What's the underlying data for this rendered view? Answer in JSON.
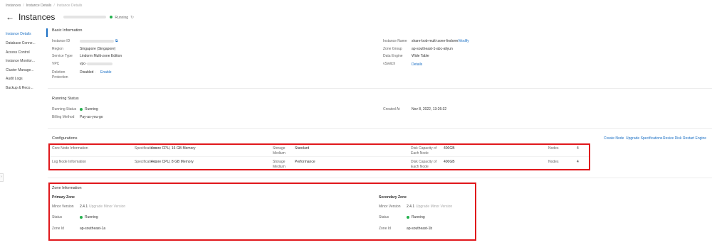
{
  "breadcrumb": [
    "Instances",
    "Instance Details",
    "Instance Details"
  ],
  "header": {
    "title": "Instances",
    "status": "Running"
  },
  "sidebar": {
    "items": [
      {
        "label": "Instance Details"
      },
      {
        "label": "Database Conne..."
      },
      {
        "label": "Access Control"
      },
      {
        "label": "Instance Monitor..."
      },
      {
        "label": "Cluster Manage..."
      },
      {
        "label": "Audit Logs"
      },
      {
        "label": "Backup & Reco..."
      }
    ]
  },
  "basic": {
    "title": "Basic Information",
    "instance_id_label": "Instance ID",
    "region_label": "Region",
    "region": "Singapore (Singapore)",
    "service_type_label": "Service Type",
    "service_type": "Lindorm Multi-zone Edition",
    "vpc_label": "VPC",
    "vpc_prefix": "vpc-",
    "deletion_label_1": "Deletion",
    "deletion_label_2": "Protection",
    "deletion_value": "Disabled",
    "enable_link": "Enable",
    "instance_name_label": "Instance Name",
    "instance_name": "share-bob-multi-zone-lindorm",
    "modify_link": "Modify",
    "zone_group_label": "Zone Group",
    "zone_group": "ap-southeast-1-abc-aliyun",
    "data_engine_label": "Data Engine",
    "data_engine": "Wide Table",
    "vswitch_label": "vSwitch",
    "details_link": "Details"
  },
  "running": {
    "title": "Running Status",
    "status_label": "Running Status",
    "status": "Running",
    "billing_label": "Billing Method",
    "billing": "Pay-as-you-go",
    "created_label": "Created At",
    "created": "Nov 8, 2022, 13:26:32"
  },
  "config": {
    "title": "Configurations",
    "actions": [
      "Create Node",
      "Upgrade Specifications",
      "Resize Disk",
      "Restart Engine"
    ],
    "rows": [
      {
        "name": "Core Node Information",
        "spec_label": "Specifications",
        "spec": "4-core CPU, 16 GB Memory",
        "medium_label_1": "Storage",
        "medium_label_2": "Medium",
        "medium": "Standard",
        "disk_label_1": "Disk Capacity of",
        "disk_label_2": "Each Node",
        "disk": "400GB",
        "nodes_label": "Nodes",
        "nodes": "4"
      },
      {
        "name": "Log Node Information",
        "spec_label": "Specifications",
        "spec": "4-core CPU, 8 GB Memory",
        "medium_label_1": "Storage",
        "medium_label_2": "Medium",
        "medium": "Performance",
        "disk_label_1": "Disk Capacity of",
        "disk_label_2": "Each Node",
        "disk": "400GB",
        "nodes_label": "Nodes",
        "nodes": "4"
      }
    ]
  },
  "zone": {
    "title": "Zone Information",
    "primary": {
      "title": "Primary Zone",
      "minor_label": "Minor Version",
      "minor": "2.4.1",
      "upgrade": "Upgrade Minor Version",
      "status_label": "Status",
      "status": "Running",
      "zone_id_label": "Zone Id",
      "zone_id": "ap-southeast-1a"
    },
    "secondary": {
      "title": "Secondary Zone",
      "minor_label": "Minor Version",
      "minor": "2.4.1",
      "upgrade": "Upgrade Minor Version",
      "status_label": "Status",
      "status": "Running",
      "zone_id_label": "Zone Id",
      "zone_id": "ap-southeast-1b"
    }
  },
  "colors": {
    "accent": "#1a6fc4",
    "running": "#22b14c",
    "highlight": "#e0171b"
  }
}
